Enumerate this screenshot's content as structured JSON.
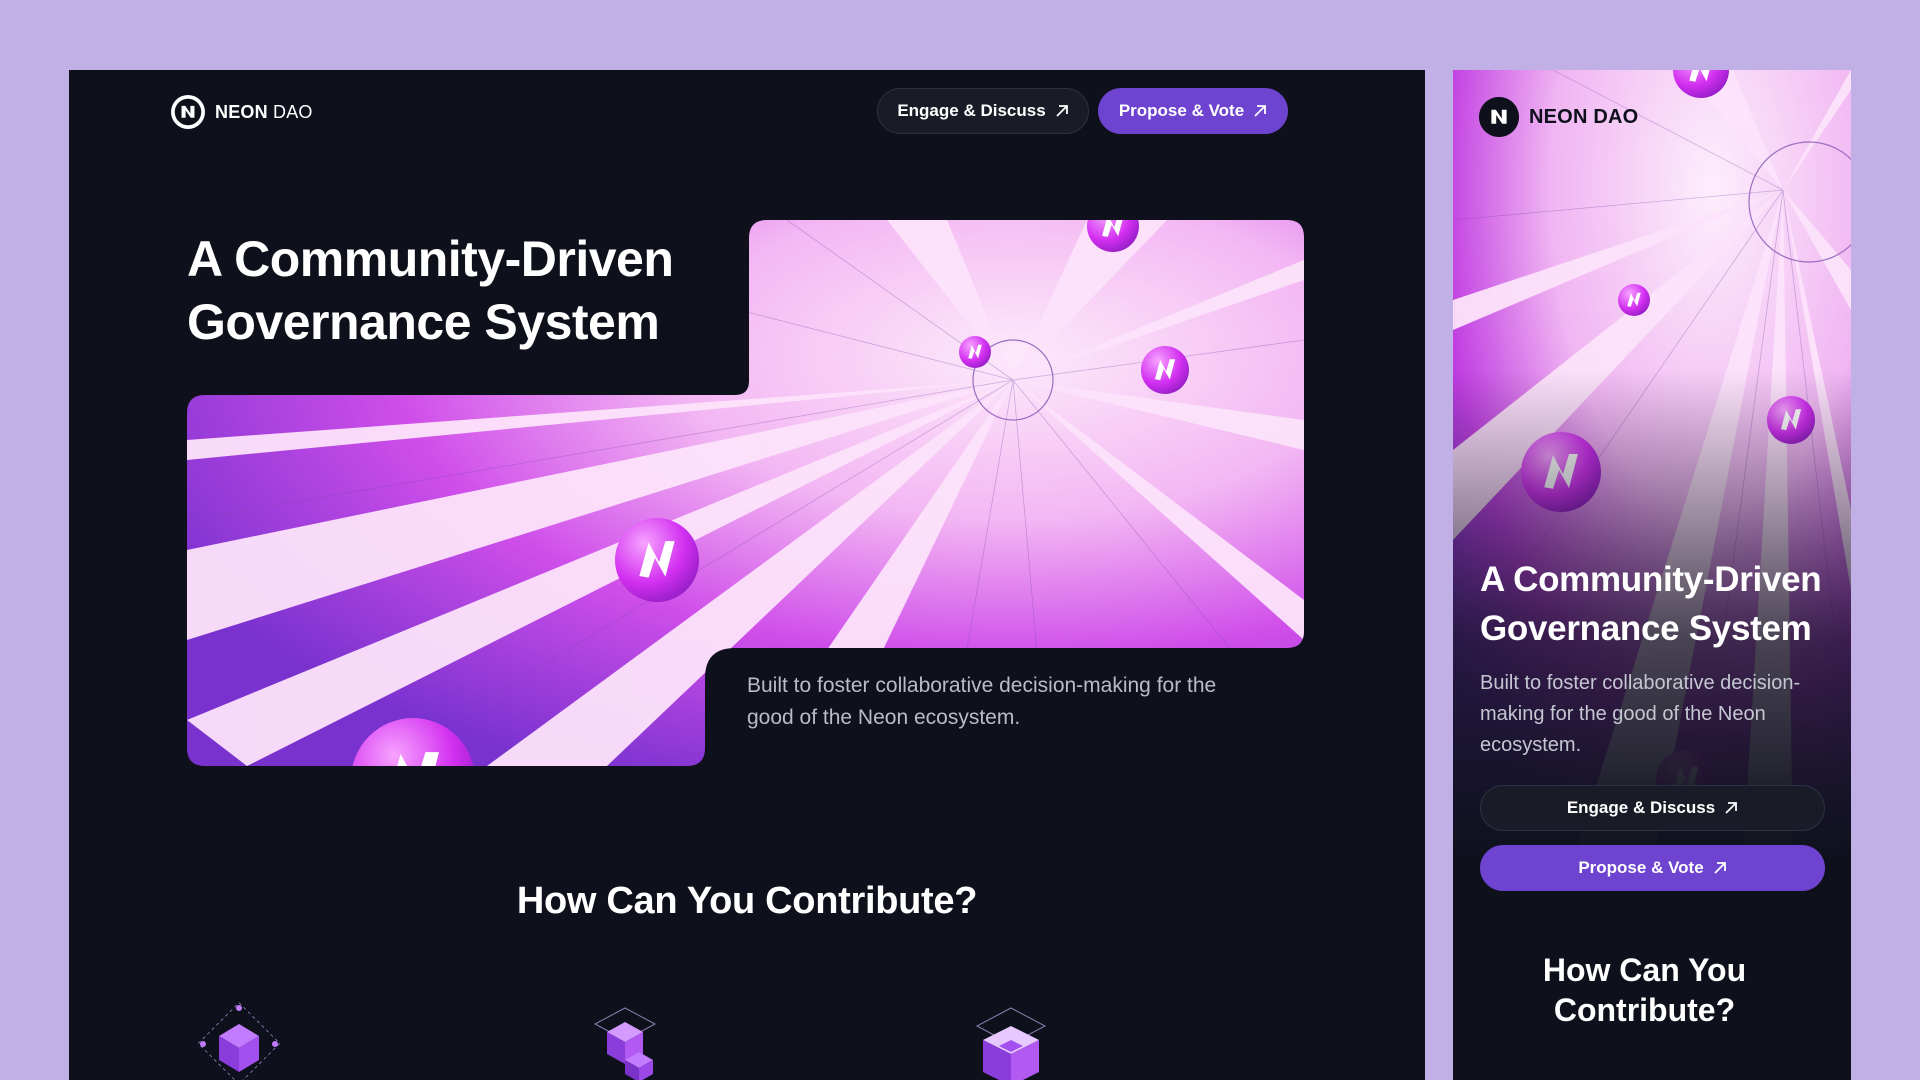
{
  "brand": {
    "name_bold": "NEON",
    "name_light": "DAO",
    "mobile_name": "NEON DAO"
  },
  "header": {
    "engage_label": "Engage & Discuss",
    "propose_label": "Propose & Vote"
  },
  "hero": {
    "title": "A Community-Driven Governance System",
    "description": "Built to foster collaborative decision-making for the good of the Neon ecosystem."
  },
  "contribute": {
    "title": "How Can You Contribute?",
    "icons": [
      "cube-network-icon",
      "cube-stack-icon",
      "cube-grid-icon"
    ]
  },
  "mobile": {
    "title": "A Community-Driven Governance System",
    "description": "Built to foster collaborative decision-making  for the good of the  Neon ecosystem.",
    "engage_label": "Engage & Discuss",
    "propose_label": "Propose & Vote",
    "section_title": "How Can You Contribute?"
  },
  "colors": {
    "page_background": "#c0b0e6",
    "panel_background": "#0e111c",
    "accent_purple": "#6d43d0",
    "magenta": "#c21fe6"
  }
}
